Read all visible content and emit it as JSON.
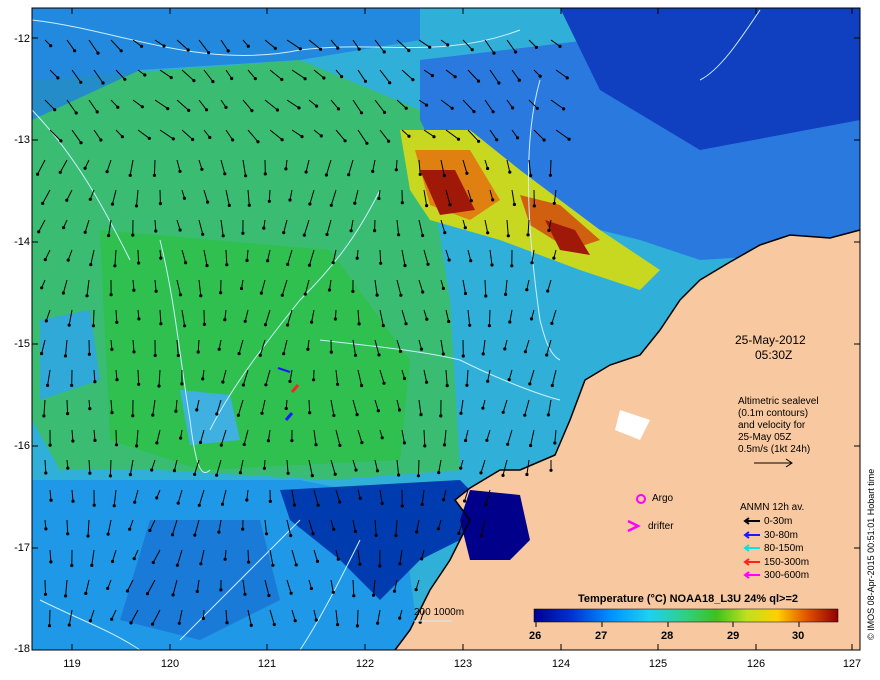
{
  "axes": {
    "y_ticks": [
      "-12",
      "-13",
      "-14",
      "-15",
      "-16",
      "-17",
      "-18"
    ],
    "x_ticks": [
      "119",
      "120",
      "121",
      "122",
      "123",
      "124",
      "125",
      "126",
      "127"
    ]
  },
  "overlay": {
    "date": "25-May-2012",
    "time": "05:30Z",
    "note_lines": [
      "Altimetric sealevel",
      "(0.1m contours)",
      "and velocity for",
      "25-May 05Z",
      "0.5m/s (1kt 24h)"
    ],
    "argo_label": "Argo",
    "drifter_label": "drifter",
    "anmn_title": "ANMN 12h av.",
    "anmn_entries": [
      {
        "label": "0-30m",
        "color": "#000000"
      },
      {
        "label": "30-80m",
        "color": "#1a1aff"
      },
      {
        "label": "80-150m",
        "color": "#00e5e5"
      },
      {
        "label": "150-300m",
        "color": "#ff2020"
      },
      {
        "label": "300-600m",
        "color": "#ff00ff"
      }
    ],
    "depth_label": "200  1000m",
    "colorbar_title": "Temperature (°C) NOAA18_L3U 24% ql>=2",
    "colorbar_ticks": [
      "26",
      "27",
      "28",
      "29",
      "30"
    ],
    "credit": "© IMOS 08-Apr-2015 00:51:01 Hobart time"
  },
  "colors": {
    "land": "#f8c8a0",
    "coast_water": "#00008b",
    "contour": "#c8f0ff",
    "argo": "#ff00ff",
    "drifter": "#ff00ff"
  }
}
